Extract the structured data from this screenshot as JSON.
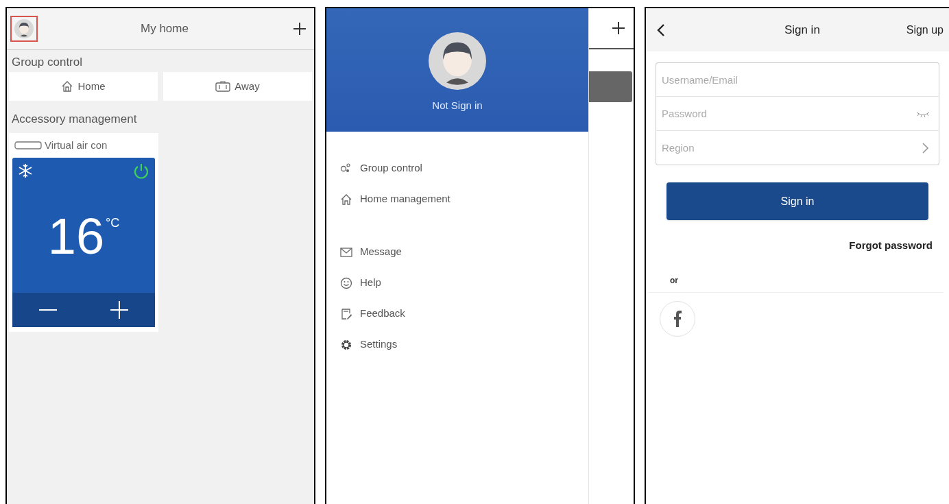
{
  "home_screen": {
    "title": "My home",
    "avatar_highlighted": true,
    "group_control": {
      "heading": "Group control",
      "buttons": [
        {
          "label": "Home",
          "kind": "home"
        },
        {
          "label": "Away",
          "kind": "away"
        }
      ]
    },
    "accessories": {
      "heading": "Accessory management",
      "device": {
        "name": "Virtual air con",
        "temperature": "16",
        "unit": "°C",
        "power_on": true
      }
    }
  },
  "drawer": {
    "status": "Not Sign in",
    "groups": [
      {
        "items": [
          {
            "label": "Group control",
            "kind": "group"
          },
          {
            "label": "Home management",
            "kind": "home"
          }
        ]
      },
      {
        "items": [
          {
            "label": "Message",
            "kind": "message"
          },
          {
            "label": "Help",
            "kind": "help"
          },
          {
            "label": "Feedback",
            "kind": "feedback"
          },
          {
            "label": "Settings",
            "kind": "settings"
          }
        ]
      }
    ]
  },
  "sign_in": {
    "title": "Sign in",
    "action": "Sign up",
    "fields": [
      {
        "placeholder": "Username/Email",
        "kind": "text"
      },
      {
        "placeholder": "Password",
        "kind": "password"
      },
      {
        "placeholder": "Region",
        "kind": "select"
      }
    ],
    "button": "Sign in",
    "forgot": "Forgot password",
    "separator": "or"
  }
}
